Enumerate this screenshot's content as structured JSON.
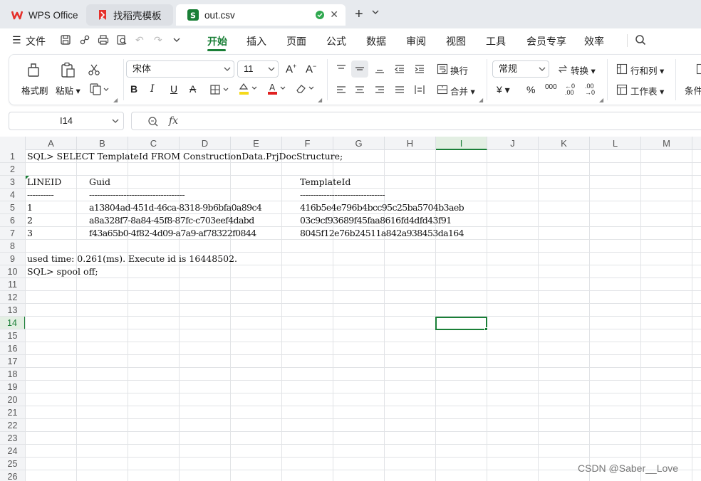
{
  "tabs": [
    {
      "label": "WPS Office",
      "icon": "wps-logo-icon"
    },
    {
      "label": "找稻壳模板",
      "icon": "daoke-logo-icon"
    },
    {
      "label": "out.csv",
      "icon": "spreadsheet-s-icon",
      "status": "saved-check-icon"
    }
  ],
  "menu": {
    "file": "文件",
    "items": [
      "开始",
      "插入",
      "页面",
      "公式",
      "数据",
      "审阅",
      "视图",
      "工具",
      "会员专享",
      "效率"
    ],
    "active": "开始"
  },
  "ribbon": {
    "format_painter": "格式刷",
    "paste": "粘贴",
    "font_name": "宋体",
    "font_size": "11",
    "bold": "B",
    "italic": "I",
    "underline": "U",
    "strike": "A",
    "wrap": "换行",
    "merge": "合并",
    "number_format": "常规",
    "convert": "转换",
    "rows_cols": "行和列",
    "worksheet": "工作表",
    "conditional": "条件",
    "currency": "¥",
    "percent": "%",
    "thousands": "000",
    "dec_inc": "←0 .00",
    "dec_dec": ".00 →0"
  },
  "formula_bar": {
    "name_box": "I14",
    "fx": "fx",
    "content": ""
  },
  "columns": [
    "A",
    "B",
    "C",
    "D",
    "E",
    "F",
    "G",
    "H",
    "I",
    "J",
    "K",
    "L",
    "M"
  ],
  "selected_column": "I",
  "rows": [
    "1",
    "2",
    "3",
    "4",
    "5",
    "6",
    "7",
    "8",
    "9",
    "10",
    "11",
    "12",
    "13",
    "14",
    "15",
    "16",
    "17",
    "18",
    "19",
    "20",
    "21",
    "22",
    "23",
    "24",
    "25",
    "26"
  ],
  "selected_row": "14",
  "cells": {
    "r1": "SQL> SELECT TemplateId FROM ConstructionData.PrjDocStructure;",
    "r3_a": "LINEID",
    "r3_b": "Guid",
    "r3_f": "TemplateId",
    "r4_a": "----------",
    "r4_b": "------------------------------------",
    "r4_f": "--------------------------------",
    "r5_a": "1",
    "r5_b": "a13804ad-451d-46ca-8318-9b6bfa0a89c4",
    "r5_f": "416b5e4e796b4bcc95c25ba5704b3aeb",
    "r6_a": "2",
    "r6_b": "a8a328f7-8a84-45f8-87fc-c703eef4dabd",
    "r6_f": "03c9cf93689f45faa8616fd4dfd43f91",
    "r7_a": "3",
    "r7_b": "f43a65b0-4f82-4d09-a7a9-af78322f0844",
    "r7_f": "8045f12e76b24511a842a938453da164",
    "r9": "used time: 0.261(ms). Execute id is 16448502.",
    "r10": "SQL> spool off;"
  },
  "watermark": "CSDN @Saber__Love",
  "colors": {
    "accent": "#1a7f37",
    "wps_red": "#e5312c"
  }
}
